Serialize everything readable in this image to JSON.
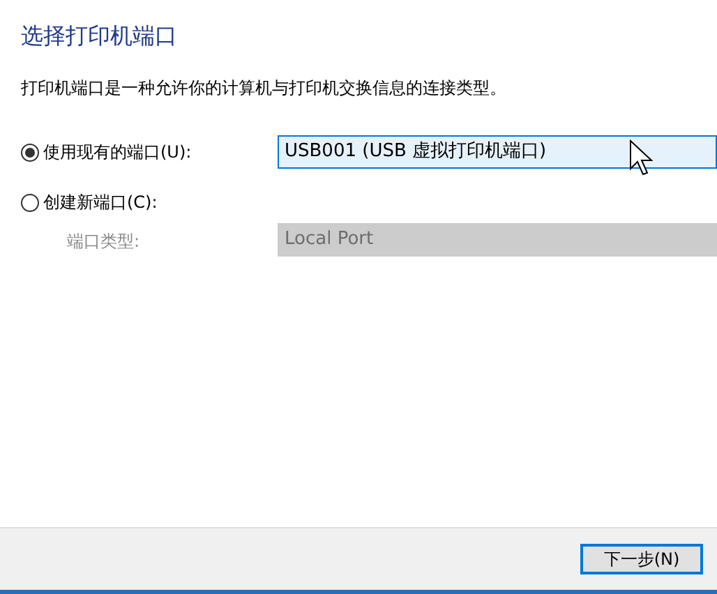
{
  "title": "选择打印机端口",
  "description": "打印机端口是一种允许你的计算机与打印机交换信息的连接类型。",
  "options": [
    {
      "label": "使用现有的端口(U):",
      "selected": true,
      "value": "USB001 (USB 虚拟打印机端口)",
      "disabled": false
    },
    {
      "label": "创建新端口(C):",
      "selected": false
    }
  ],
  "port_type": {
    "label": "端口类型:",
    "value": "Local Port",
    "disabled": true
  },
  "buttons": [
    {
      "label": "下一步(N)",
      "focused": true
    }
  ]
}
